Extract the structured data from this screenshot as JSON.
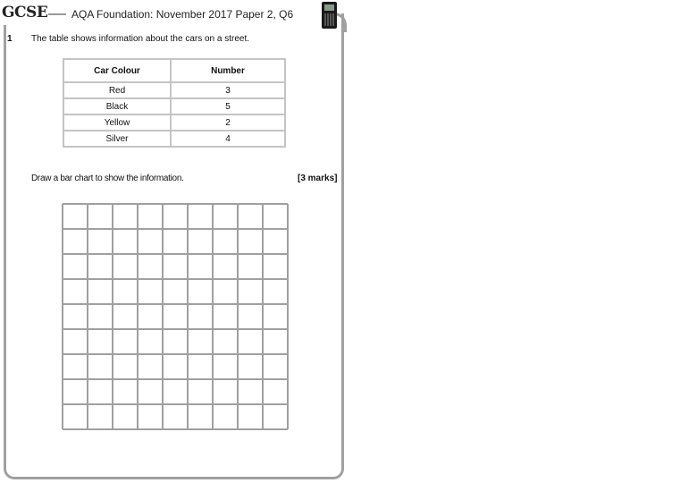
{
  "header": {
    "logo": "GCSE",
    "title": "AQA Foundation: November 2017 Paper 2, Q6",
    "icon": "calculator-icon"
  },
  "question": {
    "number": "1",
    "text": "The table shows information about the cars on a street.",
    "table": {
      "headers": [
        "Car Colour",
        "Number"
      ],
      "rows": [
        [
          "Red",
          "3"
        ],
        [
          "Black",
          "5"
        ],
        [
          "Yellow",
          "2"
        ],
        [
          "Silver",
          "4"
        ]
      ]
    },
    "instruction": "Draw a bar chart to show the information.",
    "marks": "[3 marks]"
  },
  "answer_grid": {
    "columns": 9,
    "rows": 9,
    "line_color": "#a0a0a0"
  }
}
